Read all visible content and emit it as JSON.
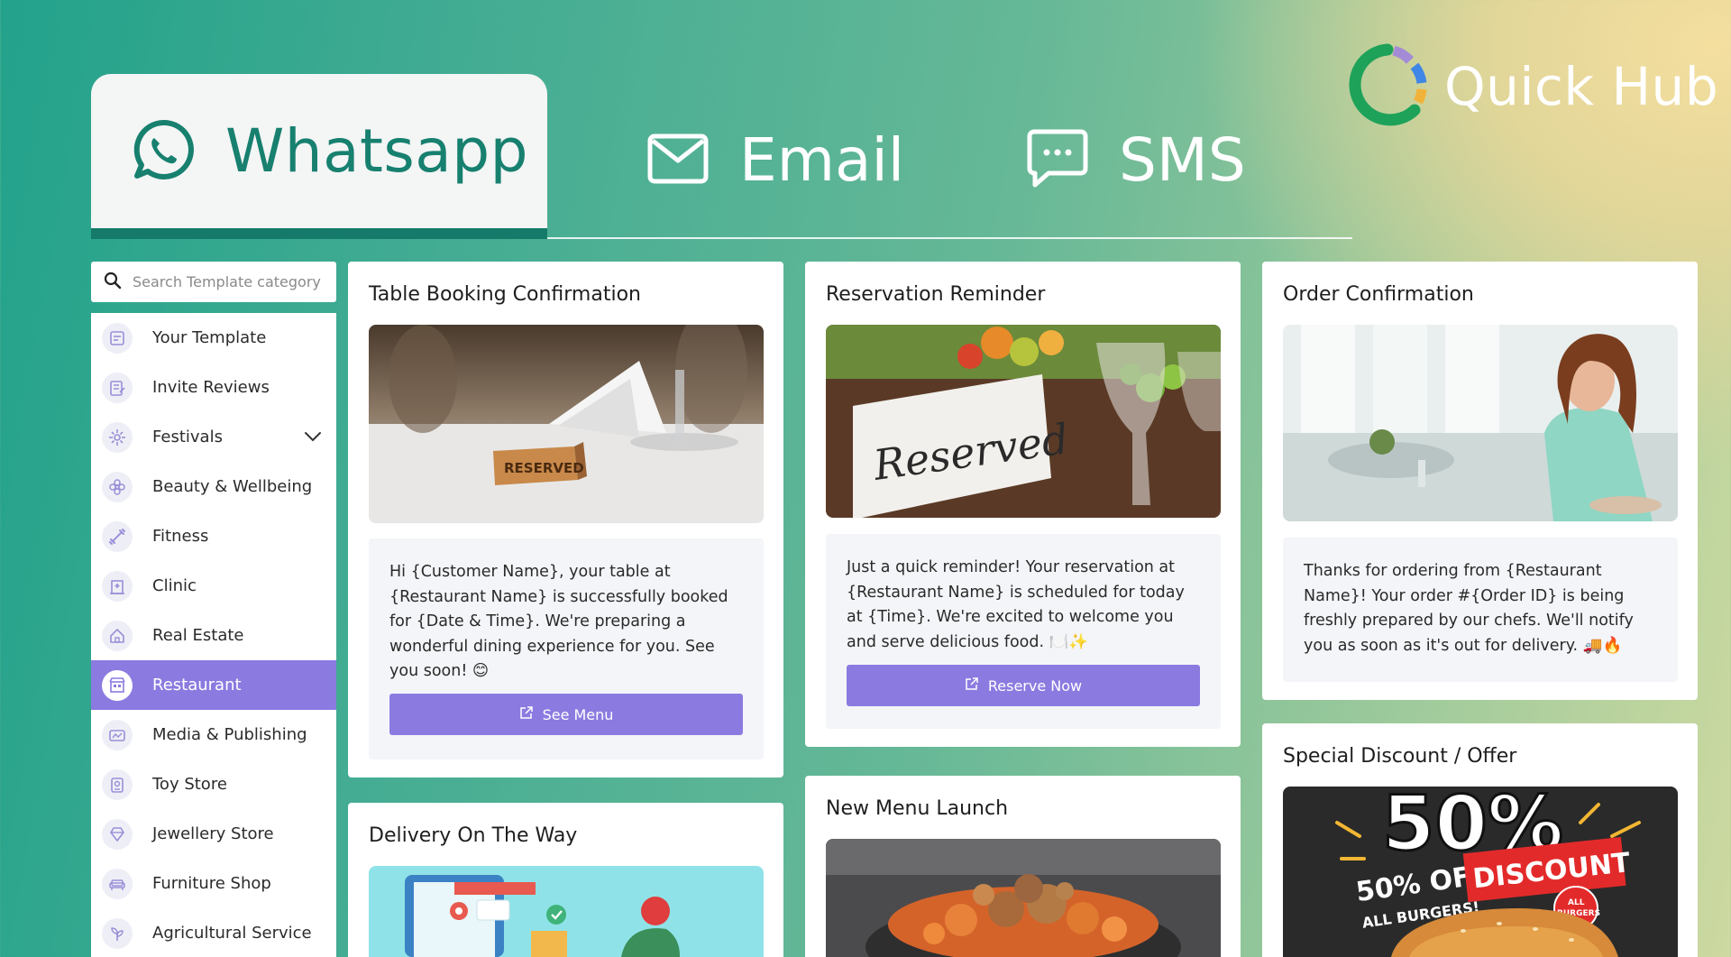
{
  "logo": {
    "name": "Quick Hub"
  },
  "tabs": [
    {
      "label": "Whatsapp",
      "icon": "whatsapp-icon",
      "active": true
    },
    {
      "label": "Email",
      "icon": "email-icon",
      "active": false
    },
    {
      "label": "SMS",
      "icon": "sms-icon",
      "active": false
    }
  ],
  "search": {
    "placeholder": "Search Template category"
  },
  "sidebar": {
    "items": [
      {
        "label": "Your Template",
        "icon": "template-icon"
      },
      {
        "label": "Invite Reviews",
        "icon": "review-icon"
      },
      {
        "label": "Festivals",
        "icon": "festival-icon",
        "expandable": true
      },
      {
        "label": "Beauty & Wellbeing",
        "icon": "flower-icon"
      },
      {
        "label": "Fitness",
        "icon": "dumbbell-icon"
      },
      {
        "label": "Clinic",
        "icon": "clinic-icon"
      },
      {
        "label": "Real Estate",
        "icon": "house-icon"
      },
      {
        "label": "Restaurant",
        "icon": "restaurant-icon",
        "active": true
      },
      {
        "label": "Media & Publishing",
        "icon": "media-icon"
      },
      {
        "label": "Toy Store",
        "icon": "toy-icon"
      },
      {
        "label": "Jewellery Store",
        "icon": "jewellery-icon"
      },
      {
        "label": "Furniture Shop",
        "icon": "sofa-icon"
      },
      {
        "label": "Agricultural Service",
        "icon": "agriculture-icon"
      }
    ]
  },
  "cards": {
    "table_booking": {
      "title": "Table Booking Confirmation",
      "message": "Hi {Customer Name}, your table at {Restaurant Name} is successfully booked for {Date & Time}. We're preparing a wonderful dining experience for you. See you soon! 😊",
      "cta": "See Menu",
      "image_text": "RESERVED"
    },
    "reservation_reminder": {
      "title": "Reservation Reminder",
      "message": "Just a quick reminder! Your reservation at {Restaurant Name} is scheduled for today at {Time}. We're excited to welcome you and serve delicious food. 🍽️✨",
      "cta": "Reserve Now",
      "image_text": "Reserved"
    },
    "order_confirmation": {
      "title": "Order Confirmation",
      "message": "Thanks for ordering from {Restaurant Name}! Your order #{Order ID} is being freshly prepared by our chefs. We'll notify you as soon as it's out for delivery. 🚚🔥"
    },
    "delivery": {
      "title": "Delivery On The Way"
    },
    "new_menu": {
      "title": "New Menu Launch"
    },
    "special_offer": {
      "title": "Special Discount / Offer",
      "image_text": {
        "big": "50%",
        "off": "50% OFF",
        "discount": "DISCOUNT",
        "all_burgers": "ALL BURGERS!",
        "badge_line1": "ALL",
        "badge_line2": "BURGERS"
      }
    }
  },
  "colors": {
    "accent": "#8b7be0",
    "whatsapp_green": "#17806f",
    "background_start": "#23a28b",
    "background_end": "#f4df9f"
  }
}
